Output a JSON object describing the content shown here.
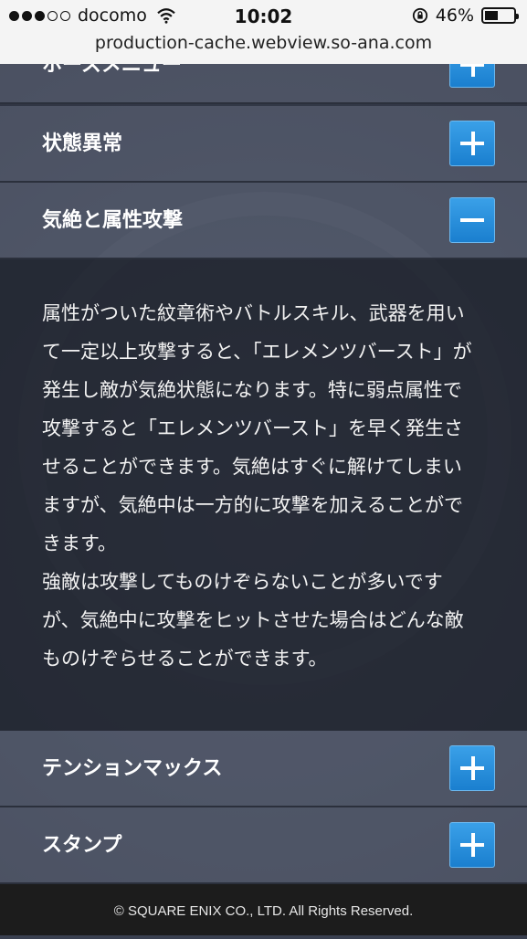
{
  "status_bar": {
    "carrier": "docomo",
    "time": "10:02",
    "battery": "46%",
    "battery_level": 0.46
  },
  "browser": {
    "url": "production-cache.webview.so-ana.com"
  },
  "accordion": {
    "top_partial_label": "ホースメニュー",
    "items": [
      {
        "label": "状態異常",
        "state": "collapsed",
        "button_icon": "plus-icon"
      },
      {
        "label": "気絶と属性攻撃",
        "state": "expanded",
        "button_icon": "minus-icon"
      },
      {
        "label": "テンションマックス",
        "state": "collapsed",
        "button_icon": "plus-icon"
      },
      {
        "label": "スタンプ",
        "state": "collapsed",
        "button_icon": "plus-icon"
      }
    ],
    "expanded_body": "属性がついた紋章術やバトルスキル、武器を用いて一定以上攻撃すると、「エレメンツバースト」が発生し敵が気絶状態になります。特に弱点属性で攻撃すると「エレメンツバースト」を早く発生させることができます。気絶はすぐに解けてしまいますが、気絶中は一方的に攻撃を加えることができます。\n強敵は攻撃してものけぞらないことが多いですが、気絶中に攻撃をヒットさせた場合はどんな敵ものけぞらせることができます。"
  },
  "footer": {
    "copyright": "© SQUARE ENIX CO., LTD. All Rights Reserved."
  },
  "colors": {
    "accent_button": "#1f8ad6",
    "footer_bg": "#1c1c1c",
    "panel_bg": "#20242e"
  }
}
